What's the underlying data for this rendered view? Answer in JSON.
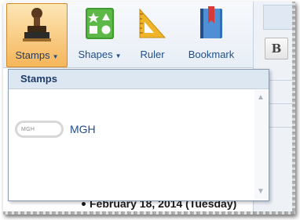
{
  "ribbon": {
    "stamps": {
      "label": "Stamps",
      "icon": "stamp-icon"
    },
    "shapes": {
      "label": "Shapes",
      "icon": "shapes-icon"
    },
    "ruler": {
      "label": "Ruler",
      "icon": "ruler-icon"
    },
    "bookmark": {
      "label": "Bookmark",
      "icon": "bookmark-icon"
    }
  },
  "side": {
    "bold_label": "B"
  },
  "dropdown": {
    "header": "Stamps",
    "items": [
      {
        "stamp_text": "MGH",
        "label": "MGH"
      }
    ]
  },
  "document": {
    "line_text": "February 18, 2014 (Tuesday)"
  },
  "colors": {
    "accent": "#f5b65b",
    "text_blue": "#1f4e8c"
  }
}
